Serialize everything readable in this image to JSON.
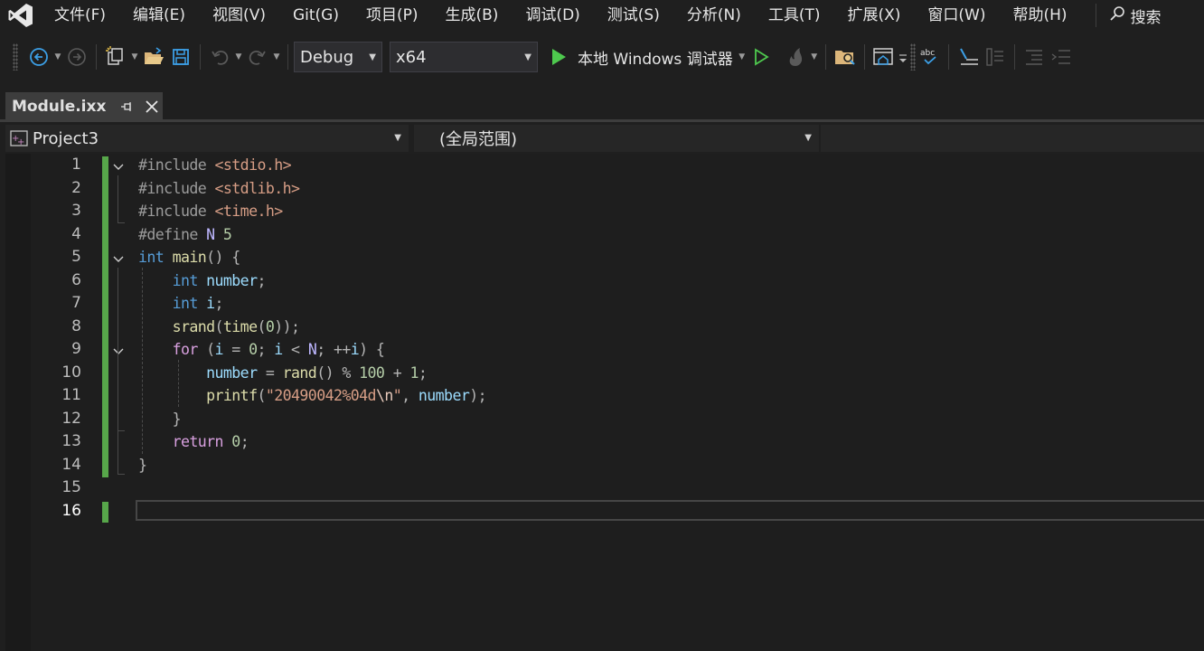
{
  "menu": {
    "items": [
      "文件(F)",
      "编辑(E)",
      "视图(V)",
      "Git(G)",
      "项目(P)",
      "生成(B)",
      "调试(D)",
      "测试(S)",
      "分析(N)",
      "工具(T)",
      "扩展(X)",
      "窗口(W)",
      "帮助(H)"
    ],
    "search_label": "搜索"
  },
  "toolbar": {
    "configuration": "Debug",
    "platform": "x64",
    "run_label": "本地 Windows 调试器"
  },
  "tab": {
    "title": "Module.ixx"
  },
  "nav": {
    "project": "Project3",
    "scope": "(全局范围)"
  },
  "editor": {
    "line_numbers": [
      "1",
      "2",
      "3",
      "4",
      "5",
      "6",
      "7",
      "8",
      "9",
      "10",
      "11",
      "12",
      "13",
      "14",
      "15",
      "16"
    ],
    "current_line": "16"
  },
  "colors": {
    "accent_green": "#57a64a",
    "run_green": "#4ec94e",
    "icon_blue": "#3c9fe6"
  }
}
